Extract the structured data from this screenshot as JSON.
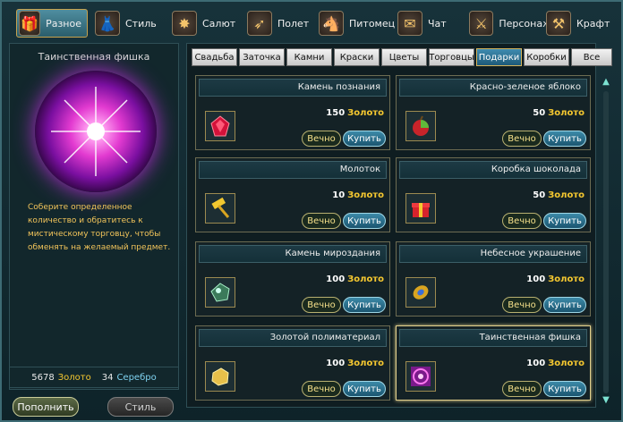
{
  "top_tabs": [
    {
      "label": "Разное",
      "icon": "gift-icon",
      "active": true
    },
    {
      "label": "Стиль",
      "icon": "outfit-icon"
    },
    {
      "label": "Салют",
      "icon": "firework-icon"
    },
    {
      "label": "Полет",
      "icon": "wing-icon"
    },
    {
      "label": "Питомец",
      "icon": "pet-icon"
    },
    {
      "label": "Чат",
      "icon": "chat-icon"
    },
    {
      "label": "Персонаж",
      "icon": "character-icon"
    },
    {
      "label": "Крафт",
      "icon": "craft-icon"
    }
  ],
  "left": {
    "item_title": "Таинственная фишка",
    "description": "Соберите определенное количество и обратитесь к мистическому торговцу, чтобы обменять на желаемый предмет.",
    "gold_amount": "5678",
    "gold_label": "Золото",
    "silver_amount": "34",
    "silver_label": "Серебро",
    "topup_label": "Пополнить",
    "style_label": "Стиль"
  },
  "sub_tabs": [
    "Свадьба",
    "Заточка",
    "Камни",
    "Краски",
    "Цветы",
    "Торговцы",
    "Подарки",
    "Коробки",
    "Все"
  ],
  "active_sub_tab": "Подарки",
  "shop": {
    "currency_label": "Золото",
    "forever_label": "Вечно",
    "buy_label": "Купить",
    "items": [
      {
        "name": "Камень познания",
        "price": "150",
        "icon": "red-crystal-icon"
      },
      {
        "name": "Красно-зеленое яблоко",
        "price": "50",
        "icon": "apple-icon"
      },
      {
        "name": "Молоток",
        "price": "10",
        "icon": "hammer-icon"
      },
      {
        "name": "Коробка шоколада",
        "price": "50",
        "icon": "gift-box-icon"
      },
      {
        "name": "Камень мироздания",
        "price": "100",
        "icon": "green-stone-icon"
      },
      {
        "name": "Небесное украшение",
        "price": "100",
        "icon": "ornament-icon"
      },
      {
        "name": "Золотой полиматериал",
        "price": "100",
        "icon": "gold-ore-icon"
      },
      {
        "name": "Таинственная фишка",
        "price": "100",
        "icon": "mystery-token-icon",
        "selected": true
      }
    ]
  },
  "colors": {
    "gold": "#f5c830",
    "silver": "#7fd2f0",
    "accent": "#3f8bb0"
  }
}
